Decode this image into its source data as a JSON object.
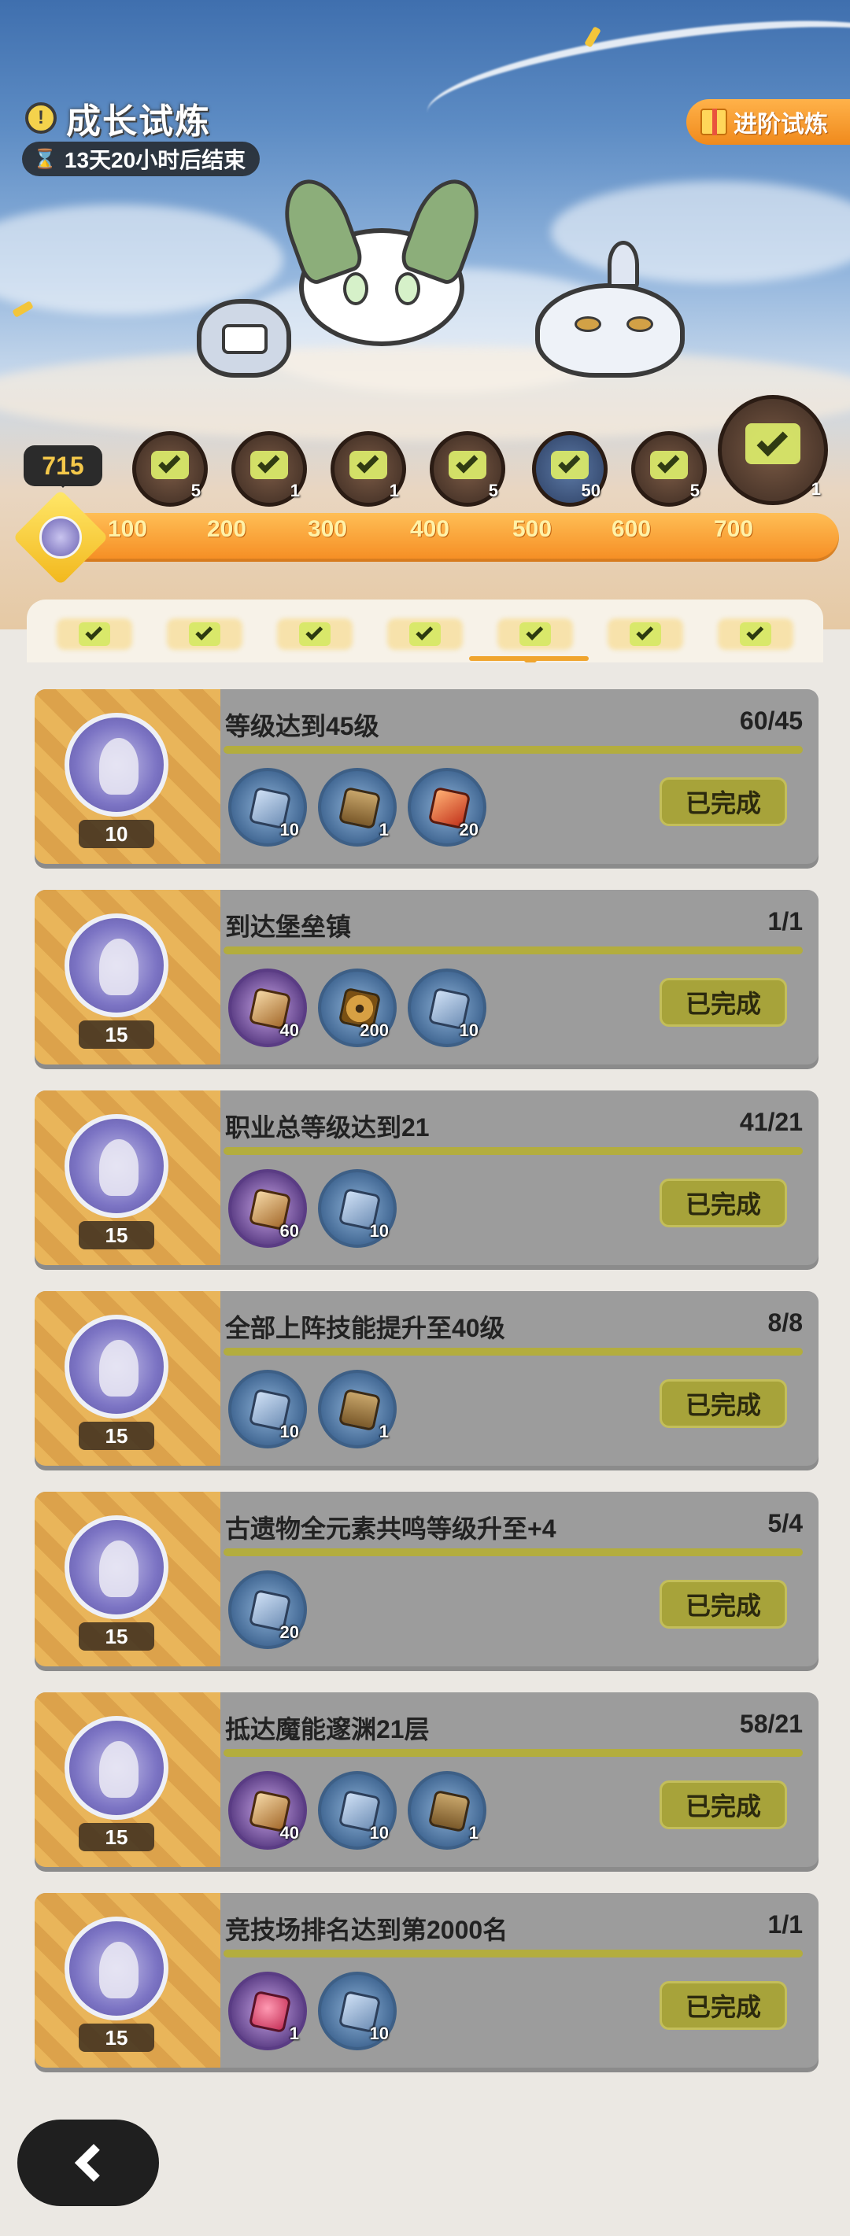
{
  "header": {
    "title": "成长试炼",
    "timer": "13天20小时后结束",
    "advanced_button": "进阶试炼"
  },
  "progress": {
    "points": "715",
    "milestones": [
      {
        "label": "100",
        "count": "5",
        "style": "brown"
      },
      {
        "label": "200",
        "count": "1",
        "style": "brown"
      },
      {
        "label": "300",
        "count": "1",
        "style": "brown"
      },
      {
        "label": "400",
        "count": "5",
        "style": "brown"
      },
      {
        "label": "500",
        "count": "50",
        "style": "blue"
      },
      {
        "label": "600",
        "count": "5",
        "style": "brown"
      },
      {
        "label": "700",
        "count": "1",
        "style": "big"
      }
    ]
  },
  "tabs": {
    "count": 7,
    "selected_index": 4
  },
  "tasks": [
    {
      "title": "等级达到45级",
      "progress": "60/45",
      "medal": "10",
      "button": "已完成",
      "rewards": [
        {
          "icon": "manual",
          "count": "10"
        },
        {
          "icon": "chest",
          "count": "1"
        },
        {
          "icon": "crystal",
          "count": "20"
        }
      ]
    },
    {
      "title": "到达堡垒镇",
      "progress": "1/1",
      "medal": "15",
      "button": "已完成",
      "rewards": [
        {
          "icon": "star",
          "count": "40"
        },
        {
          "icon": "gear",
          "count": "200"
        },
        {
          "icon": "manual",
          "count": "10"
        }
      ]
    },
    {
      "title": "职业总等级达到21",
      "progress": "41/21",
      "medal": "15",
      "button": "已完成",
      "rewards": [
        {
          "icon": "star",
          "count": "60"
        },
        {
          "icon": "manual",
          "count": "10"
        }
      ]
    },
    {
      "title": "全部上阵技能提升至40级",
      "progress": "8/8",
      "medal": "15",
      "button": "已完成",
      "rewards": [
        {
          "icon": "manual",
          "count": "10"
        },
        {
          "icon": "chest",
          "count": "1"
        }
      ]
    },
    {
      "title": "古遗物全元素共鸣等级升至+4",
      "progress": "5/4",
      "medal": "15",
      "button": "已完成",
      "rewards": [
        {
          "icon": "manual",
          "count": "20"
        }
      ]
    },
    {
      "title": "抵达魔能邃渊21层",
      "progress": "58/21",
      "medal": "15",
      "button": "已完成",
      "rewards": [
        {
          "icon": "star",
          "count": "40"
        },
        {
          "icon": "manual",
          "count": "10"
        },
        {
          "icon": "chest",
          "count": "1"
        }
      ]
    },
    {
      "title": "竞技场排名达到第2000名",
      "progress": "1/1",
      "medal": "15",
      "button": "已完成",
      "rewards": [
        {
          "icon": "apple",
          "count": "1"
        },
        {
          "icon": "manual",
          "count": "10"
        }
      ]
    }
  ],
  "colors": {
    "track": "#f58c22",
    "done_button": "#a7a33a",
    "task_card": "#9c9c9c"
  }
}
